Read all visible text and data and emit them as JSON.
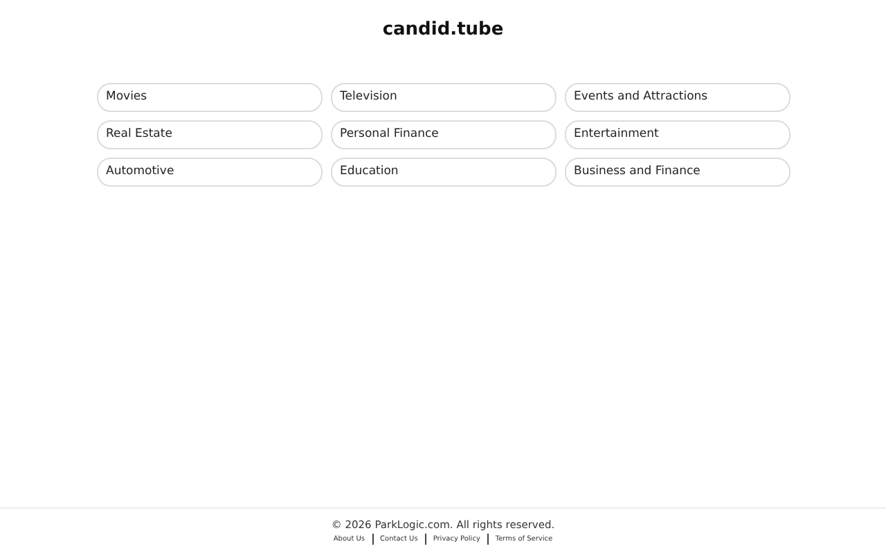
{
  "site_title": "candid.tube",
  "categories": [
    "Movies",
    "Television",
    "Events and Attractions",
    "Real Estate",
    "Personal Finance",
    "Entertainment",
    "Automotive",
    "Education",
    "Business and Finance"
  ],
  "footer": {
    "copyright": "© 2026 ParkLogic.com. All rights reserved.",
    "links": [
      "About Us",
      "Contact Us",
      "Privacy Policy",
      "Terms of Service"
    ]
  }
}
